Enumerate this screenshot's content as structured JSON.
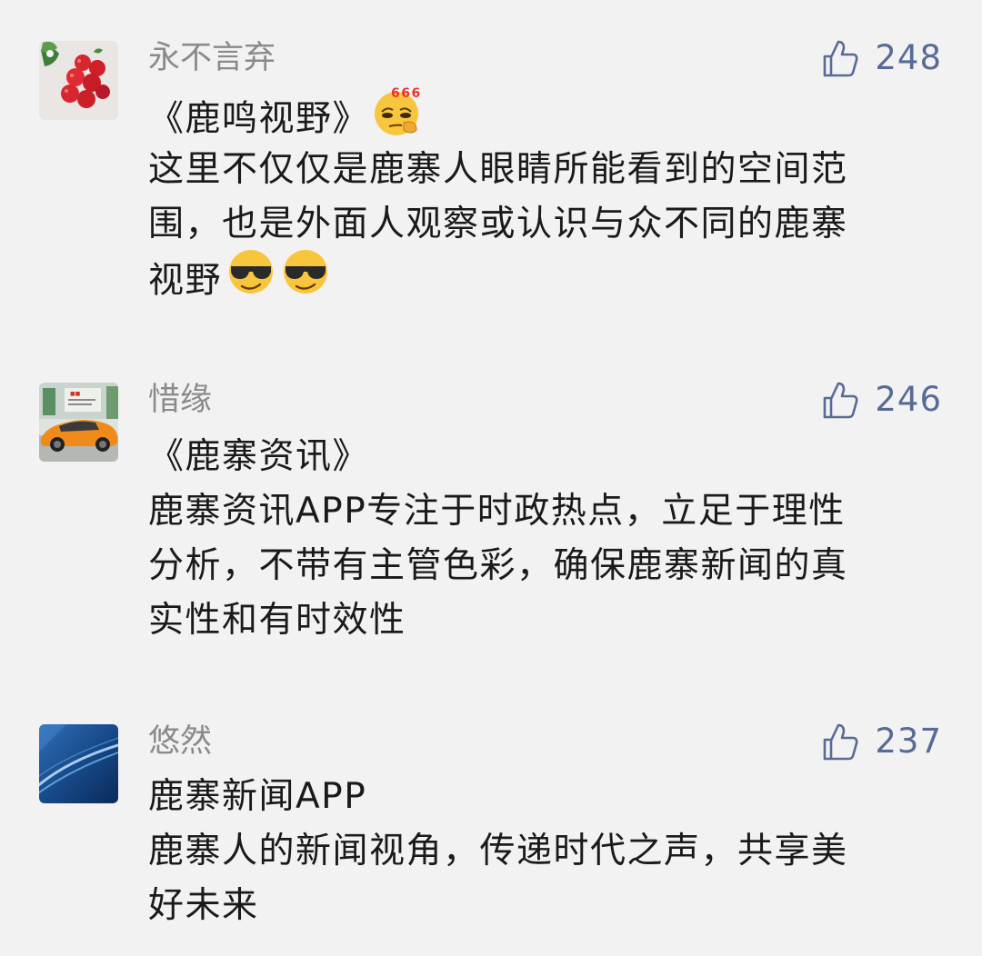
{
  "comments": [
    {
      "username": "永不言弃",
      "likes": "248",
      "avatar_icon": "strawberries-avatar",
      "lines": [
        "《鹿鸣视野》",
        "这里不仅仅是鹿寨人眼睛所能看到的空间范",
        "围，也是外面人观察或认识与众不同的鹿寨",
        "视野"
      ],
      "emoji_666_label": "666"
    },
    {
      "username": "惜缘",
      "likes": "246",
      "avatar_icon": "orange-sports-car-avatar",
      "lines": [
        "《鹿寨资讯》",
        "鹿寨资讯APP专注于时政热点，立足于理性",
        "分析，不带有主管色彩，确保鹿寨新闻的真",
        "实性和有时效性"
      ]
    },
    {
      "username": "悠然",
      "likes": "237",
      "avatar_icon": "blue-abstract-avatar",
      "lines": [
        "鹿寨新闻APP",
        "鹿寨人的新闻视角，传递时代之声，共享美",
        "好未来"
      ]
    }
  ],
  "colors": {
    "background": "#f2f2f2",
    "username": "#8a8a8a",
    "body_text": "#1a1a1a",
    "like_accent": "#576b95"
  }
}
